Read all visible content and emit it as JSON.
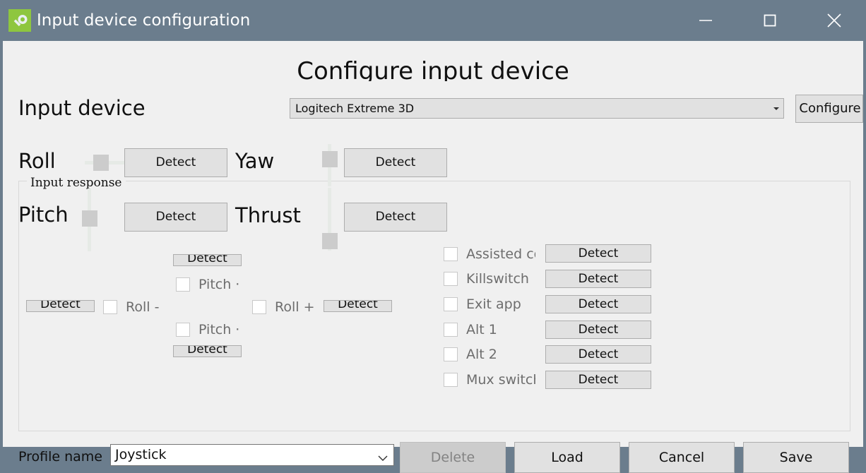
{
  "window": {
    "title": "Input device configuration",
    "icon": "magnifier-icon",
    "controls": {
      "minimize": "minimize-icon",
      "maximize": "maximize-icon",
      "close": "close-icon"
    },
    "titlebar_color": "#6b7d8d",
    "client_color": "#f0f0f0"
  },
  "heading": "Configure input device",
  "device": {
    "label": "Input device",
    "selected": "Logitech Extreme 3D",
    "configure_button": "Configure"
  },
  "input_response": {
    "legend": "Input response",
    "axes": [
      {
        "name": "Roll",
        "detect": "Detect",
        "slider": "horizontal",
        "value": 50
      },
      {
        "name": "Yaw",
        "detect": "Detect",
        "slider": "vertical",
        "value": 85
      },
      {
        "name": "Pitch",
        "detect": "Detect",
        "slider": "vertical",
        "value": 50
      },
      {
        "name": "Thrust",
        "detect": "Detect",
        "slider": "vertical",
        "value": 5
      }
    ],
    "cross": {
      "pitch_up": {
        "label": "Pitch ·",
        "detect": "Detect",
        "checked": false
      },
      "pitch_down": {
        "label": "Pitch ·",
        "detect": "Detect",
        "checked": false
      },
      "roll_minus": {
        "label": "Roll -",
        "detect": "Detect",
        "checked": false
      },
      "roll_plus": {
        "label": "Roll +",
        "detect": "Detect",
        "checked": false
      }
    },
    "switches": [
      {
        "label": "Assisted co",
        "detect": "Detect",
        "checked": false
      },
      {
        "label": "Killswitch",
        "detect": "Detect",
        "checked": false
      },
      {
        "label": "Exit app",
        "detect": "Detect",
        "checked": false
      },
      {
        "label": "Alt 1",
        "detect": "Detect",
        "checked": false
      },
      {
        "label": "Alt 2",
        "detect": "Detect",
        "checked": false
      },
      {
        "label": "Mux switch",
        "detect": "Detect",
        "checked": false
      }
    ]
  },
  "footer": {
    "profile_label": "Profile name",
    "profile_value": "Joystick",
    "buttons": {
      "delete": "Delete",
      "load": "Load",
      "cancel": "Cancel",
      "save": "Save"
    }
  }
}
